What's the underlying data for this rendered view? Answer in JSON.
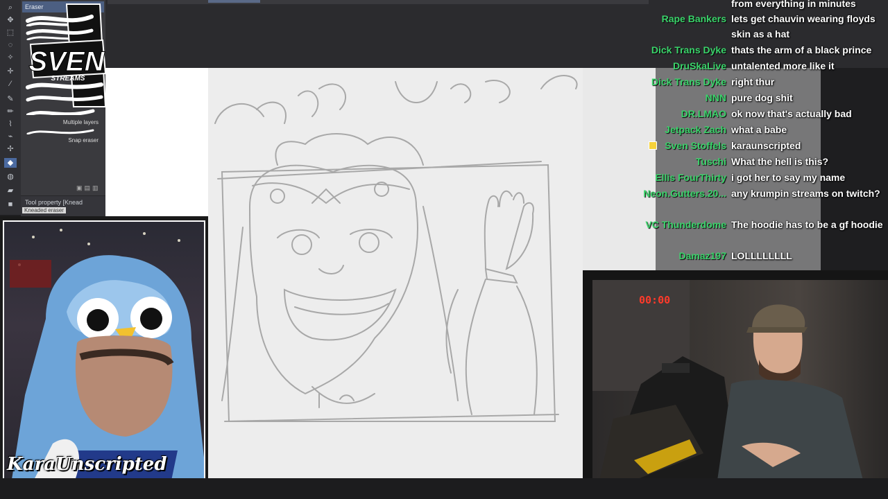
{
  "app": {
    "subtool_header": "Eraser",
    "brushes": [
      "Multiple layers",
      "Snap eraser"
    ],
    "tool_property_label": "Tool property [Knead",
    "tool_property_value": "Kneaded eraser"
  },
  "logo": {
    "name": "SVEN",
    "sub": "STREAMS"
  },
  "streamer_cam": {
    "name": "KaraUnscripted"
  },
  "host_cam": {
    "timer": "00:00"
  },
  "chat": [
    {
      "user": "",
      "text": "from everything in minutes"
    },
    {
      "user": "Rape Bankers",
      "text": "lets get chauvin wearing floyds skin as a hat"
    },
    {
      "user": "Dick Trans Dyke",
      "text": "thats the arm of a black prince"
    },
    {
      "user": "DruSkaLive",
      "text": "untalented more like it"
    },
    {
      "user": "Dick Trans Dyke",
      "text": "right thur"
    },
    {
      "user": "NNN",
      "text": "pure dog shit"
    },
    {
      "user": "DR.LMAO",
      "text": "ok now that's actually bad"
    },
    {
      "user": "Jetpack Zach",
      "text": "what a babe"
    },
    {
      "user": "Sven Stoffels",
      "text": "karaunscripted"
    },
    {
      "user": "Tuschi",
      "text": "What the hell is this?"
    },
    {
      "user": "Ellis FourThirty",
      "text": "i got her to say my name"
    },
    {
      "user": "Neon.Gutters.20...",
      "text": "any krumpin streams on twitch?"
    },
    {
      "user": "VC Thunderdome",
      "text": "The hoodie has to be a gf hoodie"
    },
    {
      "user": "Damaz197",
      "text": "LOLLLLLLLL"
    }
  ],
  "colors": {
    "chat_user": "#3ad36a",
    "timer": "#ff3a2a",
    "subtool_header": "#4c5f82"
  }
}
